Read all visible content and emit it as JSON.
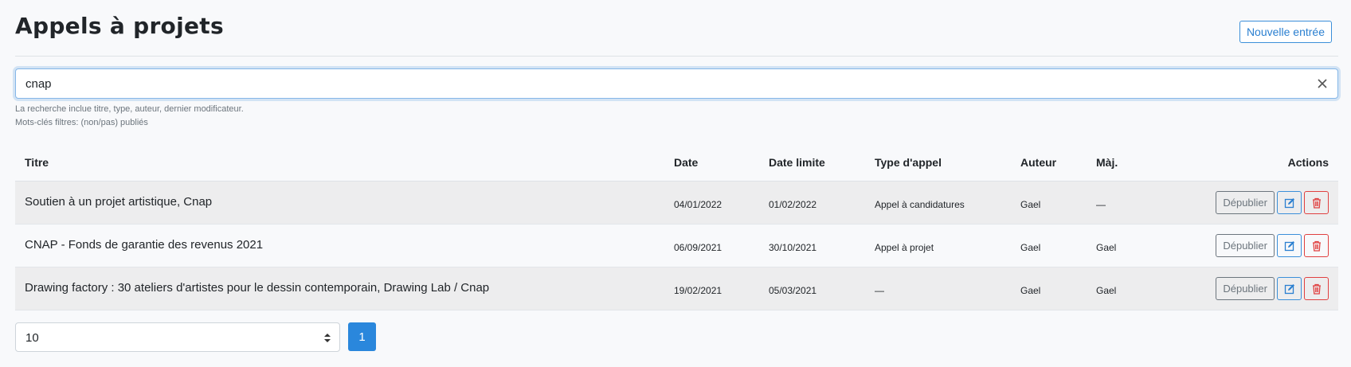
{
  "header": {
    "title": "Appels à projets",
    "new_entry_label": "Nouvelle entrée"
  },
  "search": {
    "value": "cnap",
    "placeholder": "",
    "help_line_1": "La recherche inclue titre, type, auteur, dernier modificateur.",
    "help_line_2": "Mots-clés filtres: (non/pas) publiés"
  },
  "table": {
    "columns": {
      "title": "Titre",
      "date": "Date",
      "deadline": "Date limite",
      "type": "Type d'appel",
      "author": "Auteur",
      "maj": "Màj.",
      "actions": "Actions"
    },
    "rows": [
      {
        "title": "Soutien à un projet artistique, Cnap",
        "date": "04/01/2022",
        "deadline": "01/02/2022",
        "type": "Appel à candidatures",
        "author": "Gael",
        "maj": "—",
        "unpublish_label": "Dépublier"
      },
      {
        "title": "CNAP - Fonds de garantie des revenus 2021",
        "date": "06/09/2021",
        "deadline": "30/10/2021",
        "type": "Appel à projet",
        "author": "Gael",
        "maj": "Gael",
        "unpublish_label": "Dépublier"
      },
      {
        "title": "Drawing factory : 30 ateliers d'artistes pour le dessin contemporain, Drawing Lab / Cnap",
        "date": "19/02/2021",
        "deadline": "05/03/2021",
        "type": "—",
        "author": "Gael",
        "maj": "Gael",
        "unpublish_label": "Dépublier"
      }
    ]
  },
  "pagination": {
    "per_page": "10",
    "current_page": "1"
  },
  "icons": {
    "clear": "close-icon",
    "edit": "edit-icon",
    "delete": "trash-icon",
    "select": "select-arrows-icon"
  },
  "colors": {
    "accent": "#2a87dc",
    "danger": "#e04040",
    "muted": "#6c757d",
    "stripe": "#ededee"
  }
}
